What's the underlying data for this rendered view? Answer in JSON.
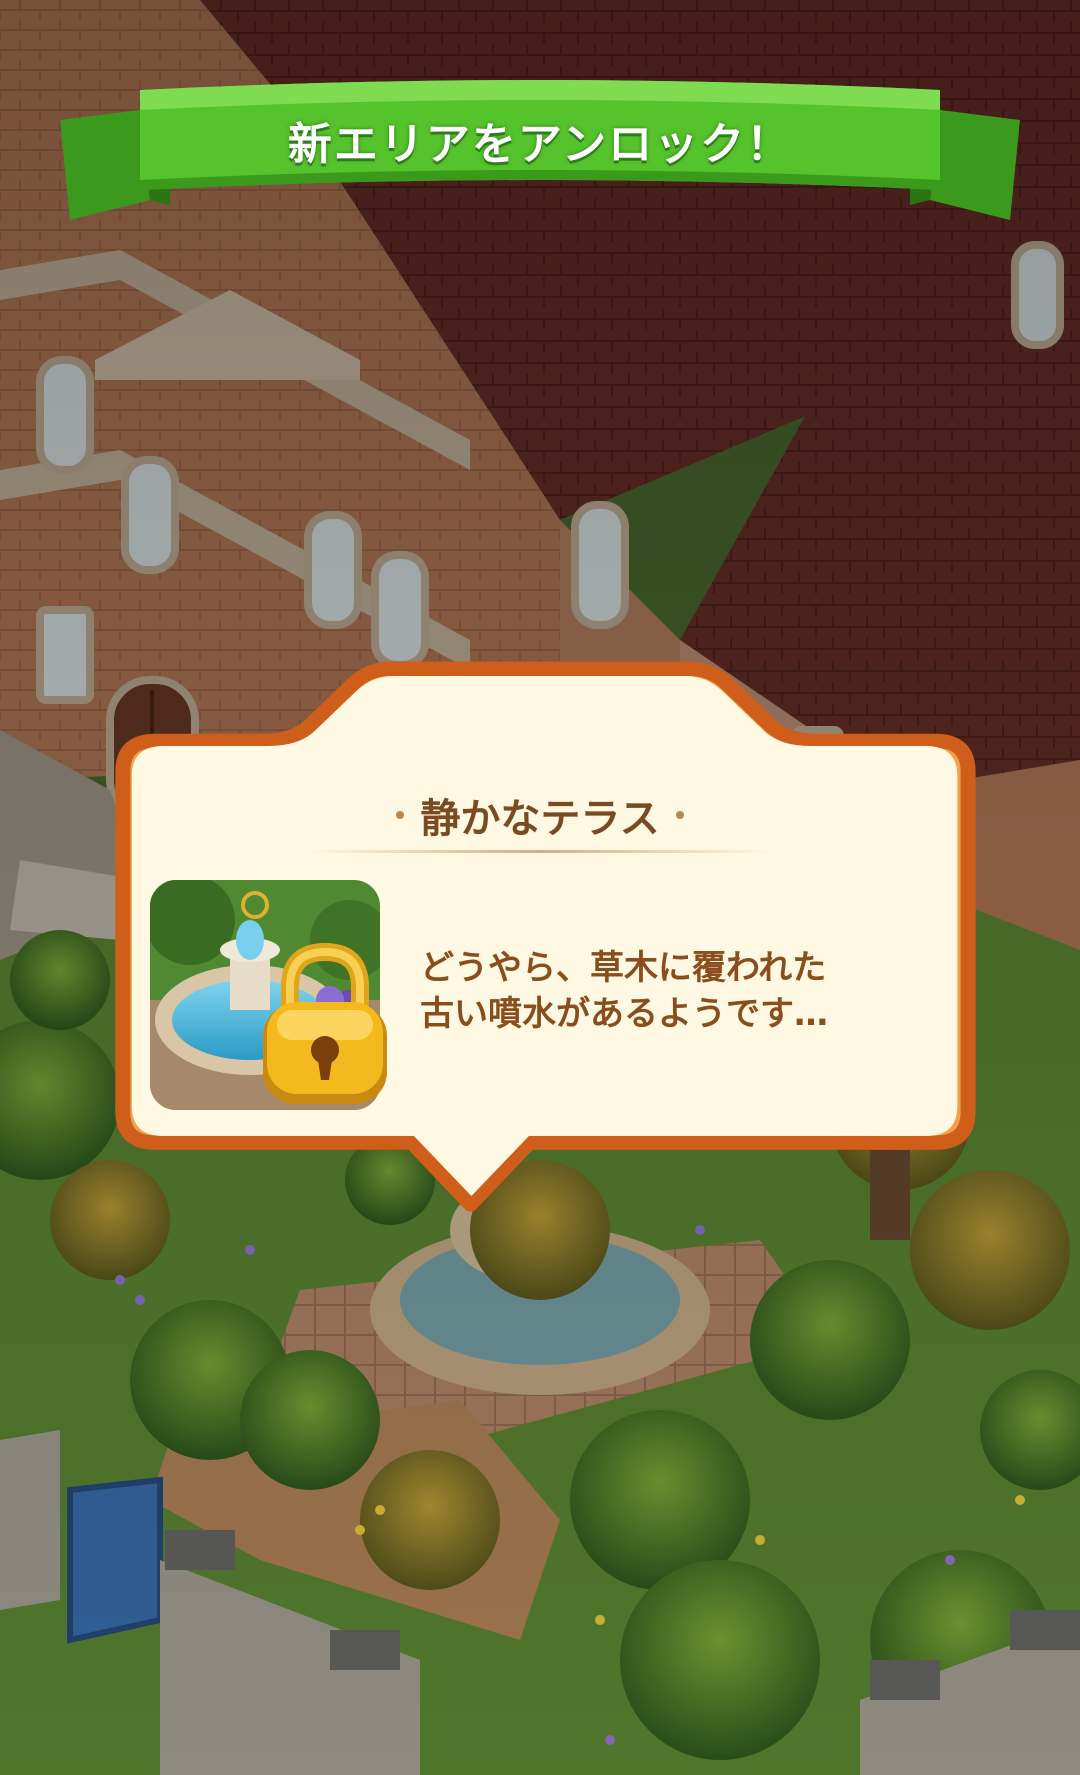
{
  "banner": {
    "title": "新エリアをアンロック！"
  },
  "area_dialog": {
    "area_name": "静かなテラス",
    "message": "どうやら、草木に覆われた\n古い噴水があるようです…",
    "thumbnail_icon": "fountain-area-thumbnail",
    "lock_icon": "padlock-icon"
  },
  "colors": {
    "banner_green": "#4fbf2a",
    "dialog_border": "#d5691f",
    "dialog_fill": "#fff8e1",
    "text_brown": "#8a4e1e",
    "lock_gold": "#f1b51d"
  }
}
